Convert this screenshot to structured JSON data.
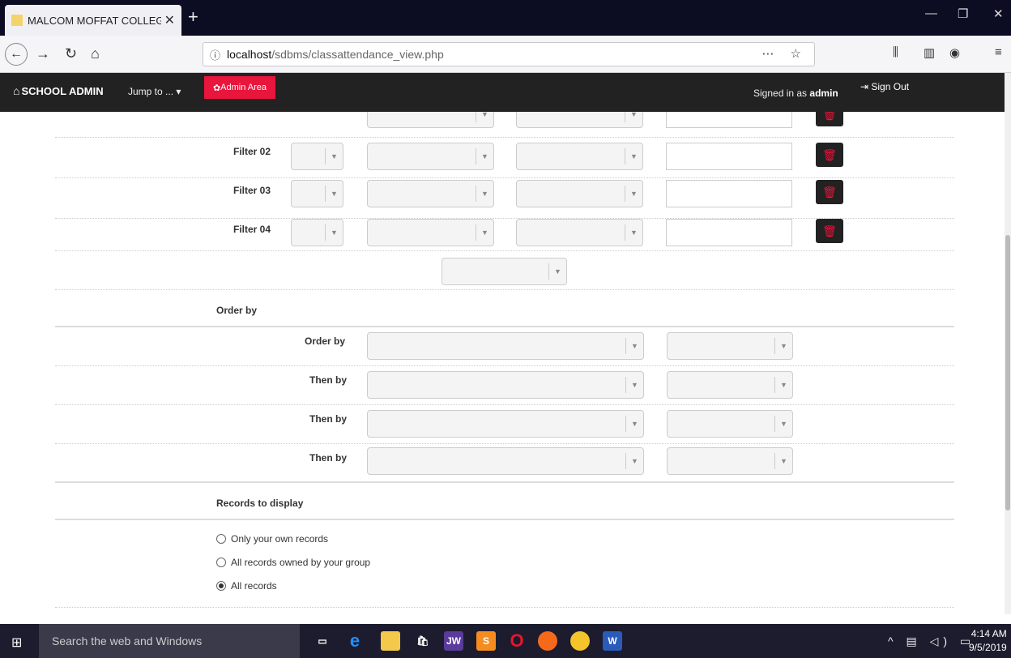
{
  "browser": {
    "tab_title_main": "MALCOM MOFFAT COLLEGE",
    "tab_title_fade": " O",
    "url_host": "localhost",
    "url_path": "/sdbms/classattendance_view.php"
  },
  "header": {
    "brand": "SCHOOL ADMIN",
    "jump": "Jump to ...",
    "admin_area": "Admin Area",
    "signed_in_prefix": "Signed in as ",
    "user": "admin",
    "sign_out": "Sign Out"
  },
  "filters": [
    {
      "label": "Filter 02"
    },
    {
      "label": "Filter 03"
    },
    {
      "label": "Filter 04"
    }
  ],
  "order_section": {
    "heading": "Order by",
    "rows": [
      {
        "label": "Order by"
      },
      {
        "label": "Then by"
      },
      {
        "label": "Then by"
      },
      {
        "label": "Then by"
      }
    ]
  },
  "records": {
    "heading": "Records to display",
    "options": [
      {
        "label": "Only your own records",
        "selected": false
      },
      {
        "label": "All records owned by your group",
        "selected": false
      },
      {
        "label": "All records",
        "selected": true
      }
    ]
  },
  "taskbar": {
    "search_placeholder": "Search the web and Windows",
    "time": "4:14 AM",
    "date": "9/5/2019"
  },
  "colors": {
    "accent_red": "#e8153c",
    "btn_green": "#3cb521",
    "btn_dark": "#222222",
    "btn_orange": "#f47c20"
  }
}
